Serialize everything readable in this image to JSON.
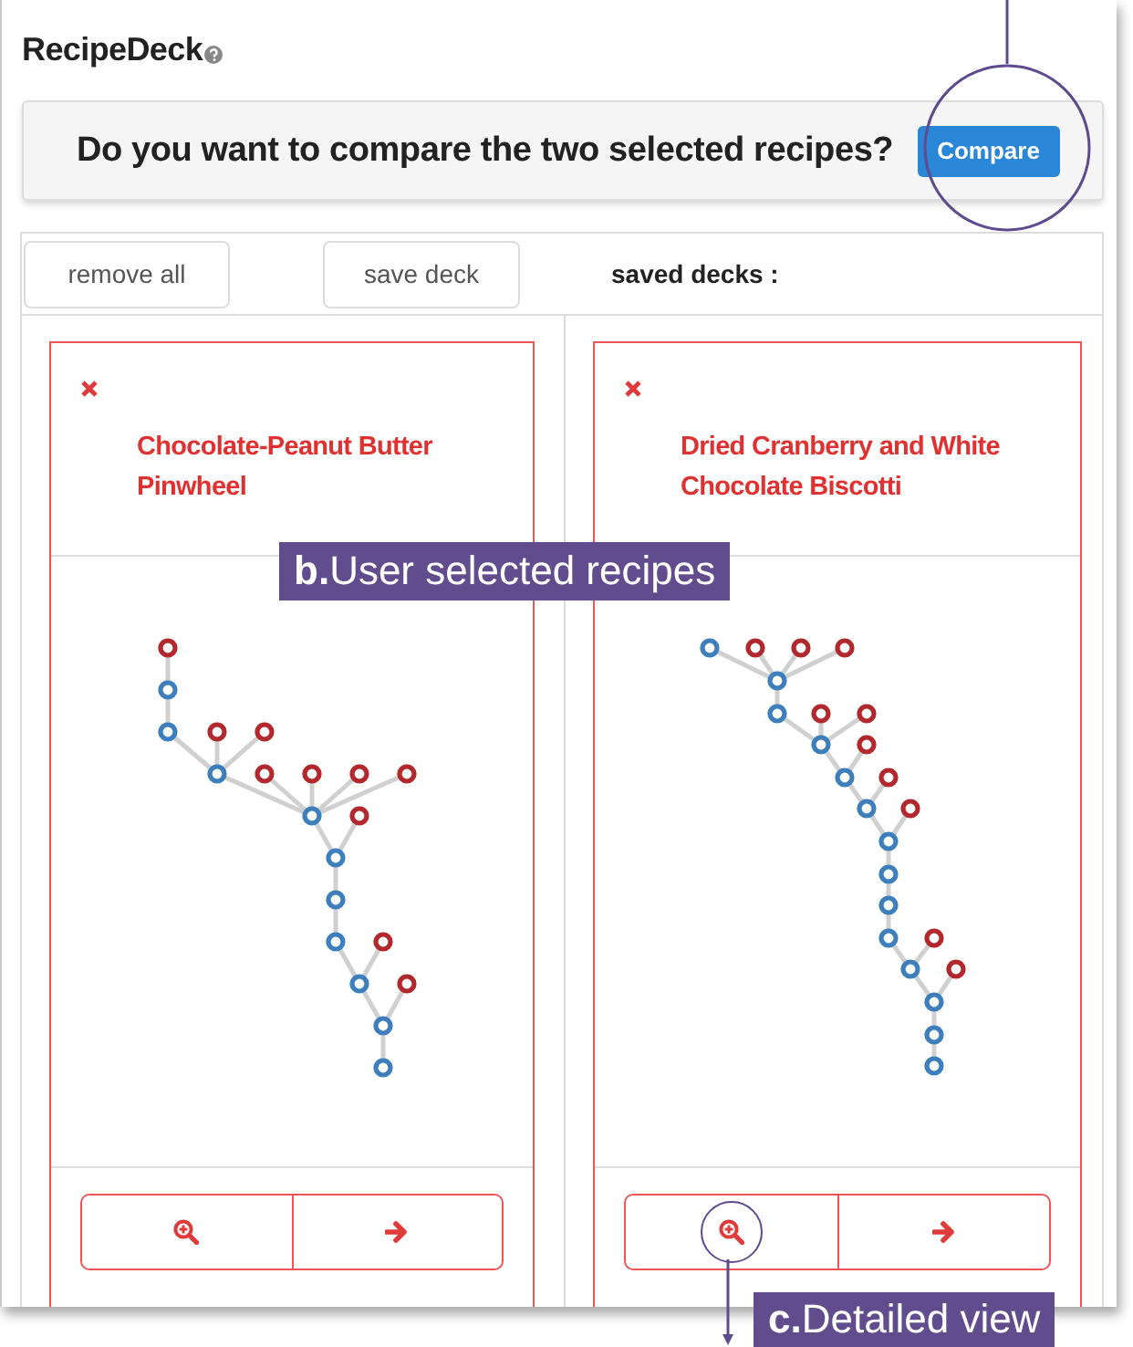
{
  "app_title": "RecipeDeck",
  "banner": {
    "question": "Do you want to compare the two selected recipes?",
    "button": "Compare"
  },
  "toolbar": {
    "buttons": [
      "remove all",
      "save deck"
    ],
    "saved_label": "saved decks :"
  },
  "cards": [
    {
      "title": "Chocolate-Peanut Butter Pinwheel",
      "highlight_zoom": false
    },
    {
      "title": "Dried Cranberry and White Chocolate Biscotti",
      "highlight_zoom": true
    }
  ],
  "annotations": [
    {
      "kind": "recipes",
      "text": "**b.**User selected recipes"
    },
    {
      "kind": "detail",
      "text": "**c.**Detailed view"
    }
  ]
}
